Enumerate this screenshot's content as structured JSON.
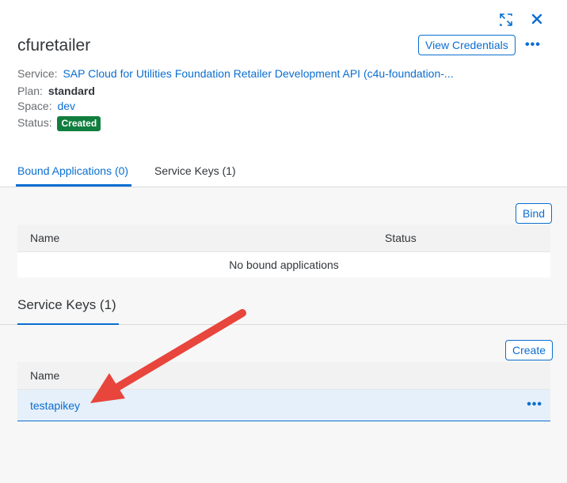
{
  "panel": {
    "title": "cfuretailer",
    "view_credentials_label": "View Credentials",
    "more_label": "•••"
  },
  "details": {
    "service_label": "Service:",
    "service_value": "SAP Cloud for Utilities Foundation Retailer Development API (c4u-foundation-...",
    "plan_label": "Plan:",
    "plan_value": "standard",
    "space_label": "Space:",
    "space_value": "dev",
    "status_label": "Status:",
    "status_value": "Created"
  },
  "tabs": [
    {
      "label": "Bound Applications (0)",
      "active": true
    },
    {
      "label": "Service Keys (1)",
      "active": false
    }
  ],
  "bound_apps": {
    "bind_label": "Bind",
    "columns": [
      "Name",
      "Status"
    ],
    "empty_text": "No bound applications"
  },
  "service_keys": {
    "section_title": "Service Keys (1)",
    "create_label": "Create",
    "columns": [
      "Name"
    ],
    "rows": [
      {
        "name": "testapikey",
        "more_label": "•••"
      }
    ]
  },
  "icons": {
    "expand": "expand-icon",
    "close": "close-icon",
    "annotation": "red-arrow-annotation"
  },
  "colors": {
    "accent": "#0a6ed1",
    "status_created": "#107e3e",
    "annotation_arrow": "#e8453c",
    "selected_row": "#e5f0fa"
  }
}
